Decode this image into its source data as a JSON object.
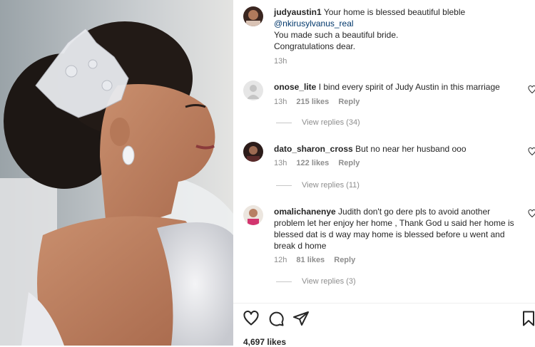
{
  "post": {
    "author": "judyaustin1",
    "caption_line1": "Your home is blessed beautiful bleble",
    "mention": "@nkirusylvanus_real",
    "caption_line2": "You made such a beautiful bride.",
    "caption_line3": "Congratulations dear.",
    "time": "13h",
    "likes": "4,697 likes"
  },
  "comments": [
    {
      "username": "onose_lite",
      "text": "I bind every spirit of Judy Austin in this marriage",
      "time": "13h",
      "likes": "215 likes",
      "reply": "Reply",
      "view_replies": "View replies (34)"
    },
    {
      "username": "dato_sharon_cross",
      "text": "But no near her husband ooo",
      "time": "13h",
      "likes": "122 likes",
      "reply": "Reply",
      "view_replies": "View replies (11)"
    },
    {
      "username": "omalichanenye",
      "text_line1": "Judith don't go dere pls to avoid another",
      "text_line2": "problem let her enjoy her home , Thank God u said her home is",
      "text_line3": "blessed dat is d way may home is blessed before u went and",
      "text_line4": "break d home",
      "time": "12h",
      "likes": "81 likes",
      "reply": "Reply",
      "view_replies": "View replies (3)"
    }
  ],
  "icons": [
    "heart-icon",
    "comment-icon",
    "share-icon",
    "bookmark-icon"
  ]
}
